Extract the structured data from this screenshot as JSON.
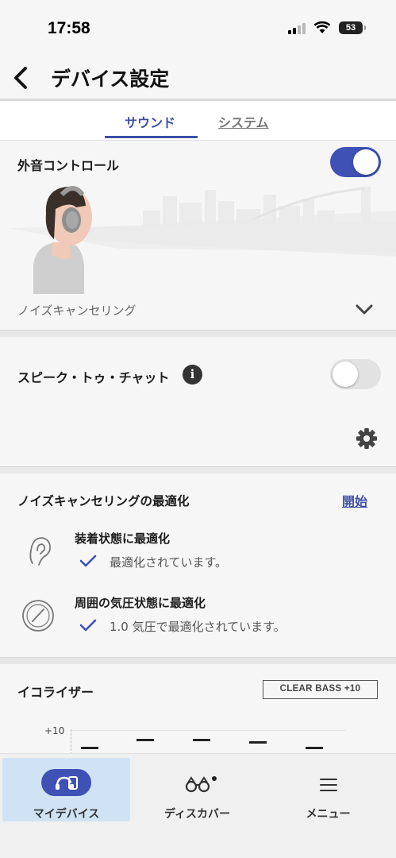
{
  "status_bar": {
    "time": "17:58",
    "battery": "53"
  },
  "header": {
    "title": "デバイス設定"
  },
  "tabs": [
    {
      "label": "サウンド",
      "active": true
    },
    {
      "label": "システム",
      "active": false
    }
  ],
  "ambient_control": {
    "label": "外音コントロール",
    "enabled": true,
    "mode": "ノイズキャンセリング"
  },
  "speak_to_chat": {
    "label": "スピーク・トゥ・チャット",
    "enabled": false
  },
  "nc_optimizer": {
    "title": "ノイズキャンセリングの最適化",
    "start_label": "開始",
    "items": [
      {
        "title": "装着状態に最適化",
        "status": "最適化されています。"
      },
      {
        "title": "周囲の気圧状態に最適化",
        "status": "1.0 気圧で最適化されています。"
      }
    ]
  },
  "equalizer": {
    "title": "イコライザー",
    "preset": "CLEAR BASS +10",
    "axis_label": "+10"
  },
  "bottom_nav": [
    {
      "label": "マイデバイス",
      "icon": "headphones-device-icon",
      "active": true
    },
    {
      "label": "ディスカバー",
      "icon": "binoculars-icon",
      "active": false
    },
    {
      "label": "メニュー",
      "icon": "hamburger-menu-icon",
      "active": false
    }
  ],
  "colors": {
    "accent": "#3f51b5",
    "active_nav": "#cfe3f5"
  }
}
